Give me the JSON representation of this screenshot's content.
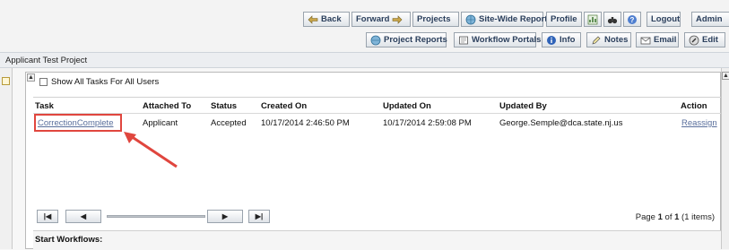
{
  "nav": {
    "back": "Back",
    "forward": "Forward",
    "projects": "Projects",
    "site_wide_reports": "Site-Wide Reports",
    "profile": "Profile",
    "logout": "Logout",
    "admin": "Admin"
  },
  "subnav": {
    "project_reports": "Project Reports",
    "workflow_portals": "Workflow Portals",
    "info": "Info",
    "notes": "Notes",
    "email": "Email",
    "edit": "Edit"
  },
  "project": {
    "title": "Applicant Test Project"
  },
  "tasks": {
    "show_all_label": "Show All Tasks For All Users",
    "columns": [
      "Task",
      "Attached To",
      "Status",
      "Created On",
      "Updated On",
      "Updated By",
      "Action"
    ],
    "rows": [
      {
        "task": "CorrectionComplete",
        "attached_to": "Applicant",
        "status": "Accepted",
        "created_on": "10/17/2014 2:46:50 PM",
        "updated_on": "10/17/2014 2:59:08 PM",
        "updated_by": "George.Semple@dca.state.nj.us",
        "action": "Reassign"
      }
    ],
    "pager": {
      "first": "|◀",
      "prev": "◀",
      "next": "▶",
      "last": "▶|",
      "page_prefix": "Page ",
      "page_current": "1",
      "page_of": " of ",
      "page_total": "1",
      "page_items": " (1 items)"
    }
  },
  "start_workflows": {
    "label": "Start Workflows:"
  },
  "colors": {
    "highlight": "#e0463e",
    "link": "#5a6f9c",
    "button_text": "#2b3f5c"
  },
  "icons": [
    "back-arrow-icon",
    "forward-arrow-icon",
    "globe-icon",
    "chart-icon",
    "binoculars-icon",
    "help-icon",
    "report-icon",
    "portal-icon",
    "info-icon",
    "notes-icon",
    "email-icon",
    "edit-icon"
  ]
}
